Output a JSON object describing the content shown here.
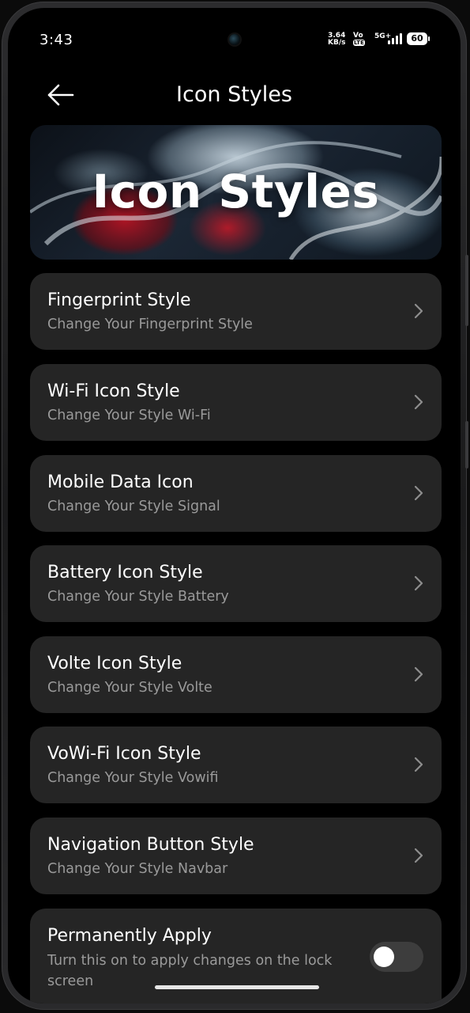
{
  "status_bar": {
    "time": "3:43",
    "net_speed_value": "3.64",
    "net_speed_unit": "KB/s",
    "volte_top": "Vo",
    "volte_bottom": "LTE",
    "network_type": "5G+",
    "battery": "60"
  },
  "header": {
    "title": "Icon Styles"
  },
  "banner": {
    "text": "Icon Styles"
  },
  "items": [
    {
      "title": "Fingerprint Style",
      "subtitle": "Change Your Fingerprint Style"
    },
    {
      "title": "Wi-Fi Icon Style",
      "subtitle": "Change Your Style Wi-Fi"
    },
    {
      "title": "Mobile Data Icon",
      "subtitle": "Change Your Style Signal"
    },
    {
      "title": "Battery Icon Style",
      "subtitle": "Change Your Style Battery"
    },
    {
      "title": "Volte Icon Style",
      "subtitle": "Change Your Style Volte"
    },
    {
      "title": "VoWi-Fi Icon Style",
      "subtitle": "Change Your Style Vowifi"
    },
    {
      "title": "Navigation Button Style",
      "subtitle": "Change Your Style Navbar"
    }
  ],
  "permanent_apply": {
    "title": "Permanently Apply",
    "subtitle": "Turn this on to apply changes on the lock screen",
    "enabled": false
  },
  "icons": {
    "back": "arrow-left-icon",
    "chevron": "chevron-right-icon",
    "signal": "signal-bars-icon",
    "battery": "battery-icon",
    "camera": "front-camera-icon"
  }
}
